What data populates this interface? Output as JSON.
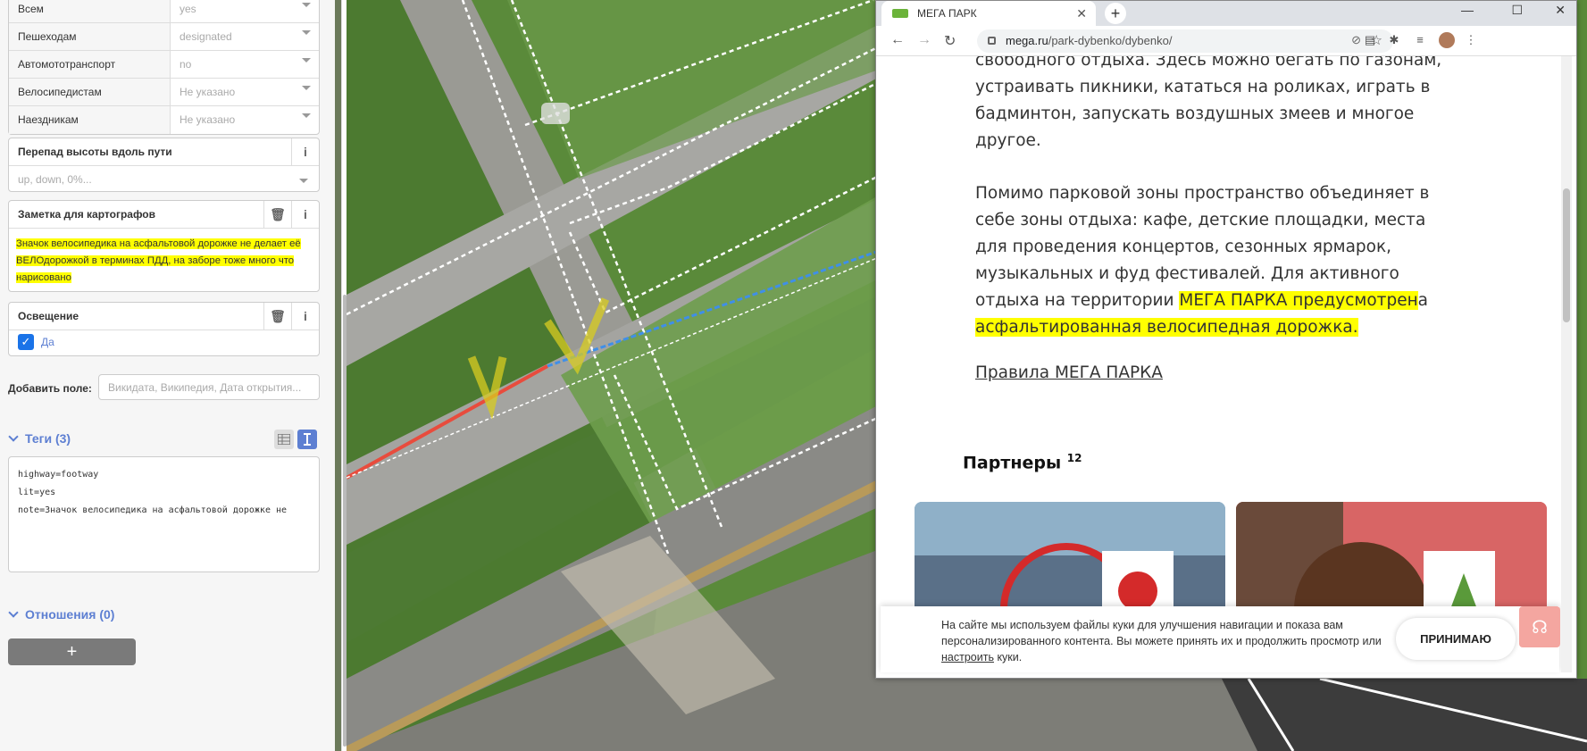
{
  "sidebar": {
    "access_rows": [
      {
        "key": "Всем",
        "value": "yes"
      },
      {
        "key": "Пешеходам",
        "value": "designated"
      },
      {
        "key": "Автомототранспорт",
        "value": "no"
      },
      {
        "key": "Велосипедистам",
        "value": "Не указано"
      },
      {
        "key": "Наездникам",
        "value": "Не указано"
      }
    ],
    "incline": {
      "label": "Перепад высоты вдоль пути",
      "placeholder": "up, down, 0%..."
    },
    "note": {
      "label": "Заметка для картографов",
      "value": "Значок велосипедика на асфальтовой дорожке не делает её ВЕЛОдорожкой в терминах ПДД, на заборе тоже много что нарисовано"
    },
    "lit": {
      "label": "Освещение",
      "value": "Да"
    },
    "add_field": {
      "label": "Добавить поле:",
      "placeholder": "Викидата, Википедия, Дата открытия..."
    },
    "tags": {
      "label": "Теги (3)",
      "lines": [
        "highway=footway",
        "lit=yes",
        "note=Значок велосипедика на асфальтовой дорожке не"
      ]
    },
    "relations": {
      "label": "Отношения (0)",
      "add": "+"
    }
  },
  "browser": {
    "tab_title": "МЕГА ПАРК",
    "new_tab": "+",
    "url_domain": "mega.ru",
    "url_path": "/park-dybenko/dybenko/",
    "para1": [
      "свободного отдыха. Здесь можно бегать по газонам,",
      "устраивать пикники, кататься на роликах, играть в",
      "бадминтон, запускать воздушных змеев и многое",
      "другое."
    ],
    "para2_plain": [
      "Помимо парковой зоны пространство объединяет в",
      "себе зоны отдыха: кафе, детские площадки, места",
      "для проведения концертов, сезонных ярмарок,",
      "музыкальных и фуд фестивалей. Для активного"
    ],
    "para2_line5_a": "отдыха на территории ",
    "para2_line5_hl": "МЕГА ПАРКА предусмотрен",
    "para2_line5_b": "а",
    "para2_line6": "асфальтированная велосипедная дорожка.",
    "rules_link": "Правила МЕГА ПАРКА",
    "partners_title": "Партнеры",
    "partners_count": "12",
    "cookie_text_a": "На сайте мы используем файлы куки для улучшения навигации и показа вам персонализированного контента. Вы можете принять их и продолжить просмотр или ",
    "cookie_link": "настроить",
    "cookie_text_b": " куки.",
    "accept_label": "ПРИНИМАЮ"
  },
  "colors": {
    "accent": "#5d7fd2",
    "highlight": "#ffff00",
    "map_path_red": "#e84c3d",
    "map_path_blue": "#3f8fe8"
  }
}
